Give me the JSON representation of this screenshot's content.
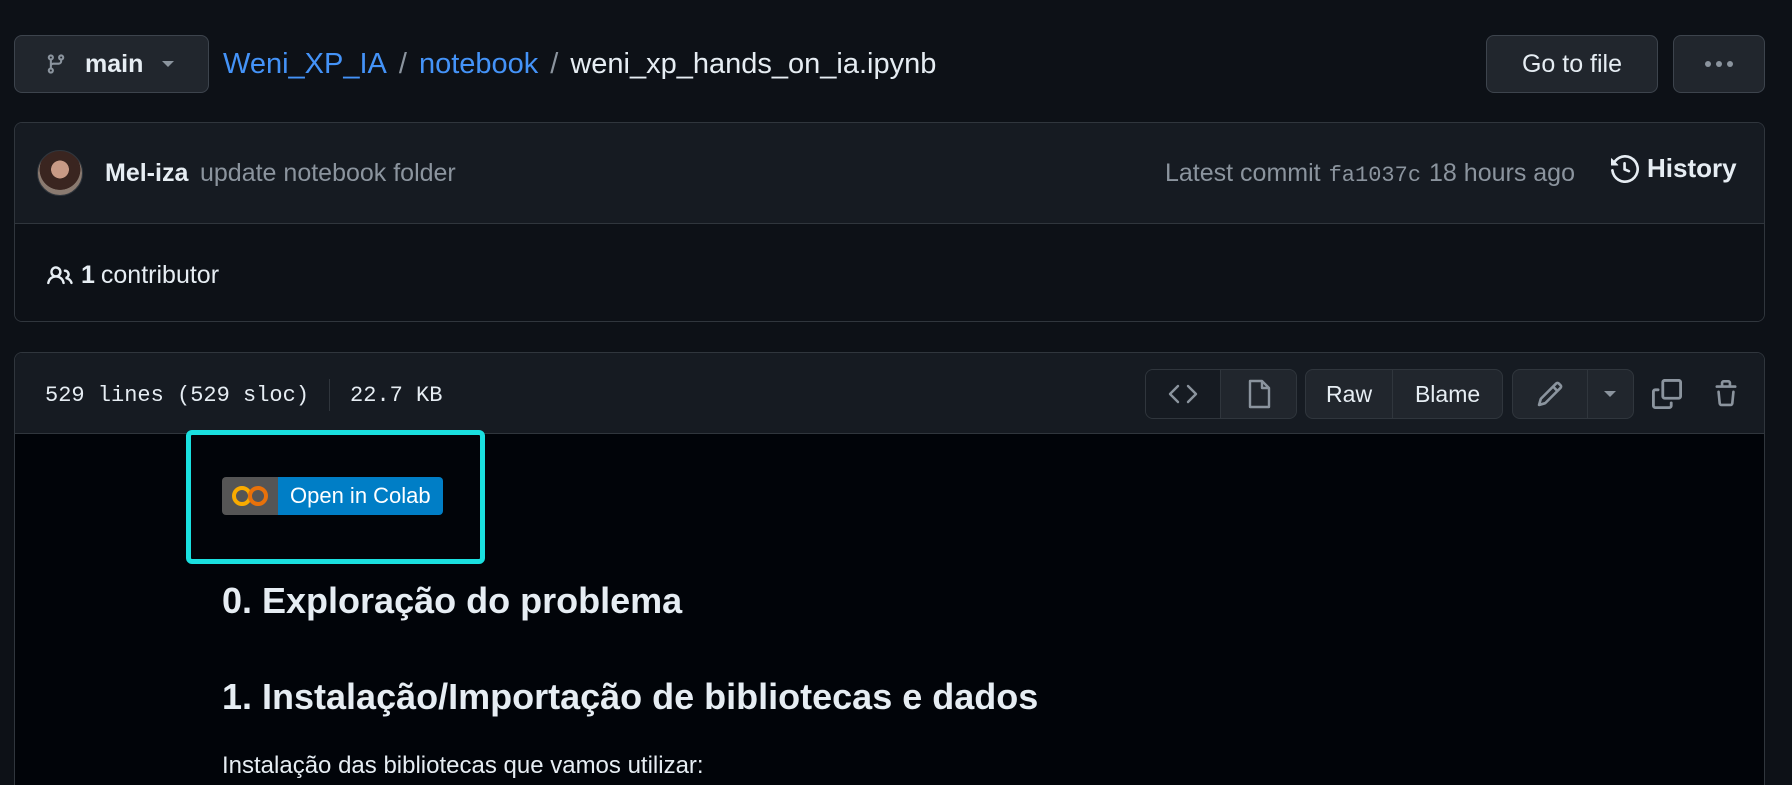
{
  "branch": {
    "label": "main"
  },
  "breadcrumb": {
    "repo": "Weni_XP_IA",
    "folder": "notebook",
    "separator": "/",
    "file": "weni_xp_hands_on_ia.ipynb"
  },
  "header_actions": {
    "go_to_file": "Go to file",
    "more_icon": "kebab-horizontal-icon"
  },
  "commit": {
    "author": "Mel-iza",
    "message": "update notebook folder",
    "latest_label": "Latest commit",
    "sha": "fa1037c",
    "time": "18 hours ago",
    "history_label": "History"
  },
  "contributors": {
    "count": "1",
    "label": "contributor"
  },
  "file": {
    "lines": "529 lines (529 sloc)",
    "size": "22.7 KB",
    "raw_label": "Raw",
    "blame_label": "Blame"
  },
  "notebook": {
    "colab_badge": "Open in Colab",
    "heading_0": "0. Exploração do problema",
    "heading_1": "1. Instalação/Importação de bibliotecas e dados",
    "paragraph_1": "Instalação das bibliotecas que vamos utilizar:"
  },
  "colors": {
    "background": "#0d1117",
    "link": "#4493f8",
    "highlight": "#1ae0e0",
    "colab_blue": "#007ec6"
  }
}
